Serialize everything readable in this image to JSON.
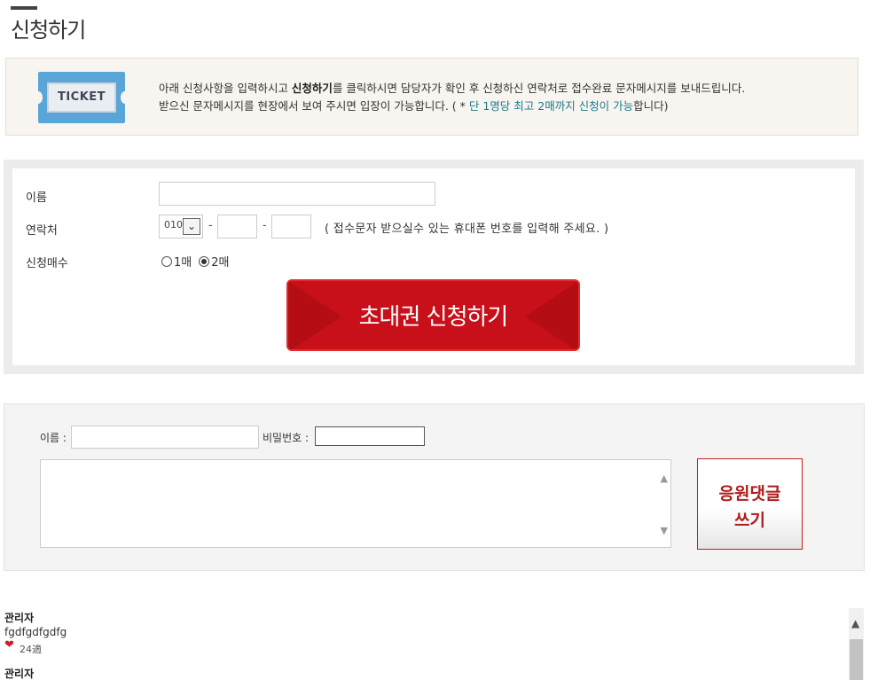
{
  "page": {
    "title": "신청하기"
  },
  "notice": {
    "ticket_label": "TICKET",
    "line1_pre": "아래 신청사항을 입력하시고 ",
    "line1_bold": "신청하기",
    "line1_post": "를 클릭하시면 담당자가 확인 후 신청하신 연락처로 접수완료 문자메시지를 보내드립니다.",
    "line2_pre": "받으신 문자메시지를 현장에서 보여 주시면 입장이 가능합니다. ( * ",
    "line2_highlight": "단 1명당 최고 2매까지 신청이 가능",
    "line2_post": "합니다)"
  },
  "form": {
    "name_label": "이름",
    "contact_label": "연락처",
    "phone_prefix_value": "010",
    "phone_dash": "-",
    "phone_help": "( 접수문자 받으실수 있는 휴대폰 번호를 입력해 주세요. )",
    "quantity_label": "신청매수",
    "quantity_options": [
      "1매",
      "2매"
    ],
    "quantity_selected": "2매",
    "submit_label": "초대권 신청하기"
  },
  "comment_form": {
    "name_label": "이름 :",
    "password_label": "비밀번호 :",
    "submit_line1": "응원댓글",
    "submit_line2": "쓰기"
  },
  "comments": [
    {
      "author": "관리자",
      "text": "fgdfgdfgdfg",
      "likes": "24適"
    }
  ],
  "next_comment_author": "관리자",
  "colors": {
    "accent_red": "#c8101a",
    "highlight_teal": "#1a7a8a"
  }
}
